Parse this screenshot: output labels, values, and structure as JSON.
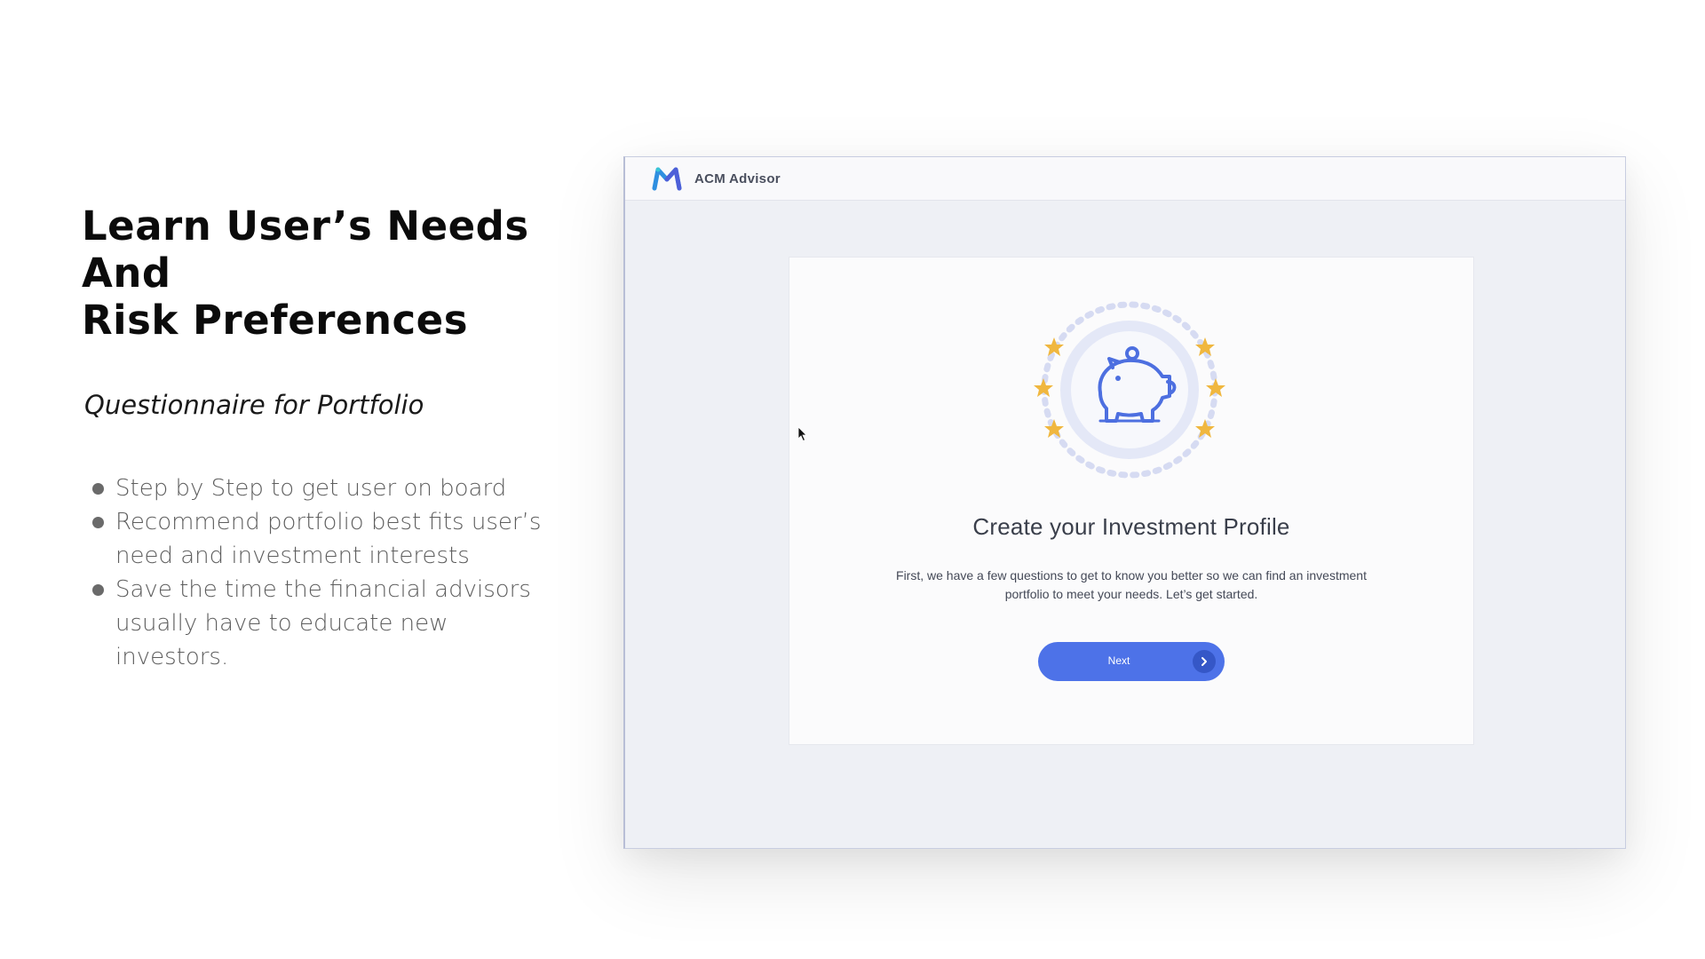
{
  "slide": {
    "headline_lines": [
      "Learn User’s Needs",
      "And",
      "Risk Preferences"
    ],
    "subtitle": "Questionnaire for Portfolio",
    "bullets": [
      "Step by Step to get user on board",
      "Recommend portfolio best fits user’s need and investment interests",
      "Save the time the financial advisors usually have to educate new investors."
    ]
  },
  "app": {
    "title": "ACM Advisor",
    "card": {
      "title": "Create your Investment Profile",
      "description": "First, we have a few questions to get to know you better so we can find an investment portfolio to meet your needs. Let’s get started.",
      "next_label": "Next"
    }
  },
  "colors": {
    "accent": "#4d72e8",
    "star": "#f0b73f",
    "background_window": "#eef0f5"
  },
  "icons": {
    "logo": "acm-logo-icon",
    "illustration": "piggy-bank-icon",
    "stars": "star-icon",
    "next_arrow": "chevron-right-icon",
    "cursor": "mouse-pointer-icon"
  }
}
